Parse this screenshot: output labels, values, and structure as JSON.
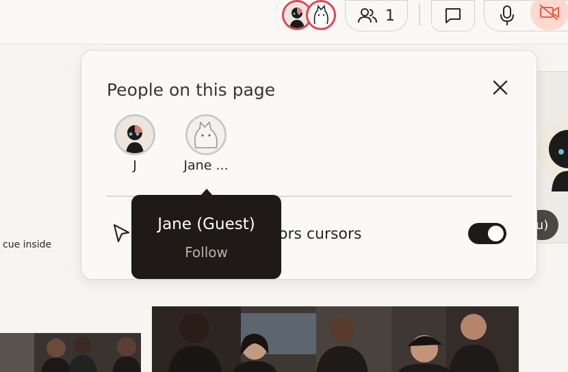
{
  "topbar": {
    "participant_count": "1",
    "colors": {
      "recording_ring": "#e0444f",
      "camera_off_bg": "#fbd9cf",
      "camera_off_icon": "#e0604a"
    },
    "icons": [
      "avatar-j-icon",
      "avatar-jane-icon",
      "people-icon",
      "chat-icon",
      "microphone-icon",
      "camera-off-icon"
    ]
  },
  "panel": {
    "title": "People on this page",
    "people": [
      {
        "label": "J",
        "avatar": "j-avatar-icon"
      },
      {
        "label": "Jane ...",
        "avatar": "cat-avatar-icon"
      }
    ],
    "cursors_label": "ors cursors",
    "cursors_toggle_on": true
  },
  "tooltip": {
    "name": "Jane (Guest)",
    "action": "Follow"
  },
  "background": {
    "side_text": "cue inside",
    "badge_text": "u)"
  }
}
